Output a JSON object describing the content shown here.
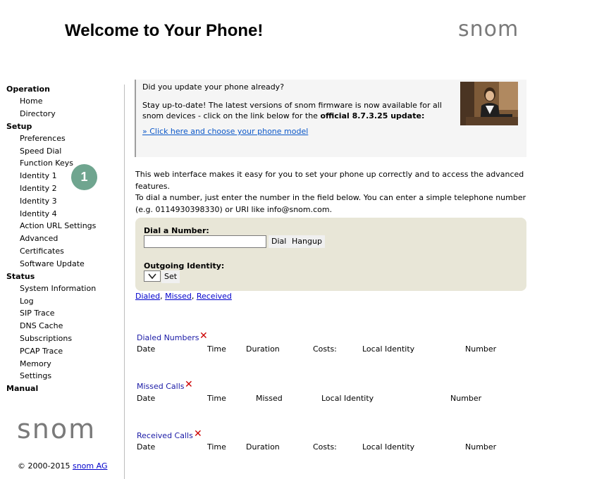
{
  "header": {
    "title": "Welcome to Your Phone!",
    "logo": "snom"
  },
  "sidebar": {
    "sections": {
      "operation": "Operation",
      "setup": "Setup",
      "status": "Status",
      "manual": "Manual"
    },
    "operation_items": [
      "Home",
      "Directory"
    ],
    "setup_items": [
      "Preferences",
      "Speed Dial",
      "Function Keys",
      "Identity 1",
      "Identity 2",
      "Identity 3",
      "Identity 4",
      "Action URL Settings",
      "Advanced",
      "Certificates",
      "Software Update"
    ],
    "status_items": [
      "System Information",
      "Log",
      "SIP Trace",
      "DNS Cache",
      "Subscriptions",
      "PCAP Trace",
      "Memory",
      "Settings"
    ],
    "logo": "snom",
    "copyright_prefix": "© 2000-2015",
    "copyright_link": "snom AG",
    "step_badge": "1"
  },
  "update": {
    "heading": "Did you update your phone already?",
    "body_prefix": "Stay up-to-date! The latest versions of snom firmware is now available for all snom devices - click on the link below for the",
    "body_bold": "official 8.7.3.25 update:",
    "link": "» Click here and choose your phone model"
  },
  "intro": {
    "line1": "This web interface makes it easy for you to set your phone up correctly and to access the advanced features.",
    "line2": "To dial a number, just enter the number in the field below. You can enter a simple telephone number (e.g. 0114930398330) or URI like info@snom.com."
  },
  "dial": {
    "label": "Dial a Number:",
    "input_value": "",
    "dial_button": "Dial",
    "hangup_button": "Hangup",
    "outgoing_label": "Outgoing Identity:",
    "set_button": "Set"
  },
  "call_links": {
    "dialed": "Dialed",
    "missed": "Missed",
    "received": "Received",
    "separator": ","
  },
  "lists": {
    "dialed": {
      "title": "Dialed Numbers",
      "columns": [
        "Date",
        "Time",
        "Duration",
        "Costs:",
        "Local Identity",
        "Number"
      ]
    },
    "missed": {
      "title": "Missed Calls",
      "columns": [
        "Date",
        "Time",
        "Missed",
        "Local Identity",
        "Number"
      ]
    },
    "received": {
      "title": "Received Calls",
      "columns": [
        "Date",
        "Time",
        "Duration",
        "Costs:",
        "Local Identity",
        "Number"
      ]
    }
  },
  "icons": {
    "delete": "close-icon",
    "delete_color": "#cc0000",
    "badge_color": "#6fa58f"
  }
}
